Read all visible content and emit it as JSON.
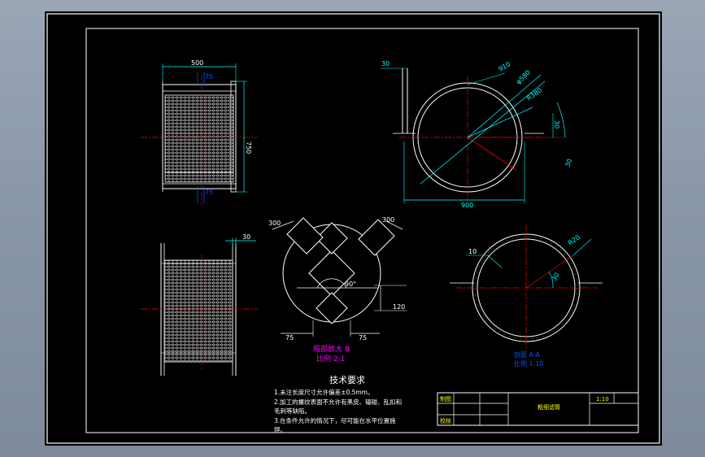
{
  "drawing": {
    "colors": {
      "frame": "#ffffff",
      "dim": "#00ffff",
      "center": "#ff0000",
      "hatch": "#ffffff",
      "part": "#ffff00"
    }
  },
  "front_view": {
    "dims": {
      "width": "500",
      "height": "750",
      "inner": "75"
    }
  },
  "side_view": {
    "dims": {
      "flange": "30"
    }
  },
  "top_right_view": {
    "dims": {
      "tab": "30",
      "thick": "910",
      "outer_diameter": "φ580",
      "outer_radius": "R380",
      "base_width": "900",
      "angle": "30",
      "slot": "30"
    }
  },
  "detail_b": {
    "dims": {
      "left_width": "300",
      "right_width": "300",
      "angle": "90°",
      "height": "120",
      "bottom_left": "75",
      "bottom_right": "75"
    },
    "caption": "局部放大 B",
    "scale": "比例 2:1"
  },
  "section_aa": {
    "dims": {
      "thickness": "10",
      "radius": "R20",
      "angle": "30"
    },
    "caption": "剖面 A-A",
    "scale": "比例 1:10"
  },
  "notes": {
    "heading": "技术要求",
    "line1": "1.未注长度尺寸允许偏差±0.5mm。",
    "line2a": "2.加工的螺纹表面不允许有黑皮、磕碰、乱扣和",
    "line2b": "毛刺等缺陷。",
    "line3a": "3.在条件允许的情况下，尽可能在水平位置施",
    "line3b": "焊。"
  },
  "title_block": {
    "row1_label": "制图",
    "row2_label": "校核",
    "part_name": "粗细滤筒",
    "scale": "1:10"
  }
}
